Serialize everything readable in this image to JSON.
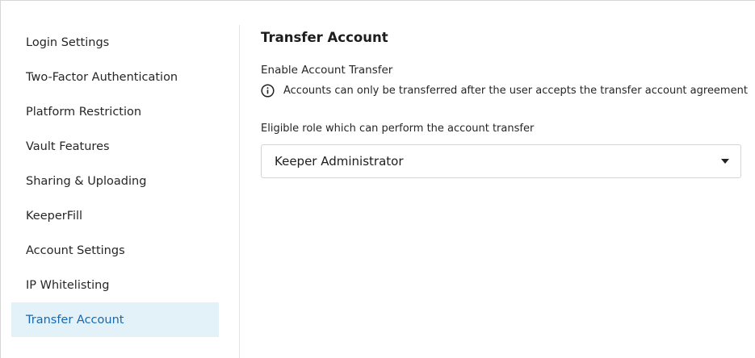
{
  "sidebar": {
    "items": [
      {
        "label": "Login Settings"
      },
      {
        "label": "Two-Factor Authentication"
      },
      {
        "label": "Platform Restriction"
      },
      {
        "label": "Vault Features"
      },
      {
        "label": "Sharing & Uploading"
      },
      {
        "label": "KeeperFill"
      },
      {
        "label": "Account Settings"
      },
      {
        "label": "IP Whitelisting"
      },
      {
        "label": "Transfer Account",
        "active": true
      }
    ]
  },
  "main": {
    "title": "Transfer Account",
    "enable_label": "Enable Account Transfer",
    "info_icon": "info-circle-icon",
    "info_text": "Accounts can only be transferred after the user accepts the transfer account agreement",
    "role_label": "Eligible role which can perform the account transfer",
    "role_select": {
      "value": "Keeper Administrator",
      "icon": "caret-down-icon"
    }
  },
  "colors": {
    "active_bg": "#e3f1f8",
    "active_text": "#1768ad",
    "divider": "#e4e4e4",
    "border": "#d4d4d4"
  }
}
